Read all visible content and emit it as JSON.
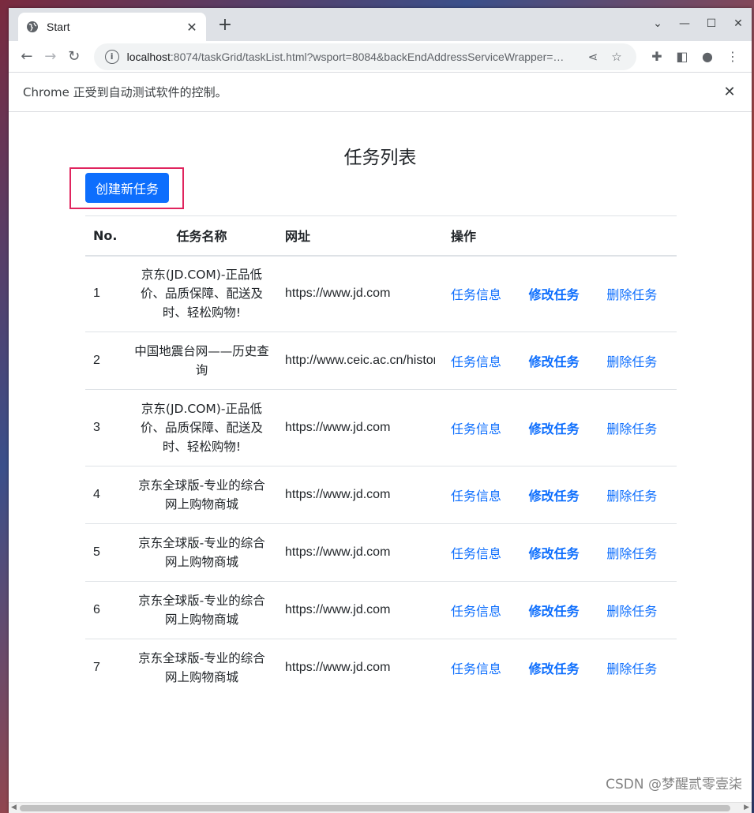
{
  "browser": {
    "tab_title": "Start",
    "url_host": "localhost",
    "url_rest": ":8074/taskGrid/taskList.html?wsport=8084&backEndAddressServiceWrapper=…",
    "infobar_message": "Chrome 正受到自动测试软件的控制。"
  },
  "page": {
    "title": "任务列表",
    "create_button": "创建新任务",
    "table": {
      "headers": {
        "no": "No.",
        "name": "任务名称",
        "url": "网址",
        "ops": "操作"
      },
      "rows": [
        {
          "no": "1",
          "name": "京东(JD.COM)-正品低价、品质保障、配送及时、轻松购物!",
          "url": "https://www.jd.com",
          "info": "任务信息",
          "edit": "修改任务",
          "delete": "删除任务"
        },
        {
          "no": "2",
          "name": "中国地震台网——历史查询",
          "url": "http://www.ceic.ac.cn/history",
          "info": "任务信息",
          "edit": "修改任务",
          "delete": "删除任务"
        },
        {
          "no": "3",
          "name": "京东(JD.COM)-正品低价、品质保障、配送及时、轻松购物!",
          "url": "https://www.jd.com",
          "info": "任务信息",
          "edit": "修改任务",
          "delete": "删除任务"
        },
        {
          "no": "4",
          "name": "京东全球版-专业的综合网上购物商城",
          "url": "https://www.jd.com",
          "info": "任务信息",
          "edit": "修改任务",
          "delete": "删除任务"
        },
        {
          "no": "5",
          "name": "京东全球版-专业的综合网上购物商城",
          "url": "https://www.jd.com",
          "info": "任务信息",
          "edit": "修改任务",
          "delete": "删除任务"
        },
        {
          "no": "6",
          "name": "京东全球版-专业的综合网上购物商城",
          "url": "https://www.jd.com",
          "info": "任务信息",
          "edit": "修改任务",
          "delete": "删除任务"
        },
        {
          "no": "7",
          "name": "京东全球版-专业的综合网上购物商城",
          "url": "https://www.jd.com",
          "info": "任务信息",
          "edit": "修改任务",
          "delete": "删除任务"
        }
      ]
    }
  },
  "watermark": "CSDN @梦醒贰零壹柒",
  "colors": {
    "accent": "#0d6efd",
    "highlight_border": "#e0245e"
  }
}
